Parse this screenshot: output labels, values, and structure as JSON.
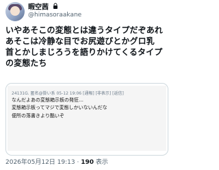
{
  "author": {
    "display_name": "暇空茜",
    "handle": "@himasoraakane"
  },
  "post": {
    "lines": [
      "いやあそこの変態とは違うタイプだぞあれ",
      "あそこは冷静な目でお尻遊びとかグロ乳",
      "首とかしまじろうを語りかけてくるタイプ",
      "の変態たち"
    ]
  },
  "embedded_post": {
    "header": "24131G. 匿名@掛い系 05-12 19:06 [通報] [非表示] [返信]",
    "lines": [
      "なんだよあの変態箱示板の発狂…",
      "変態箱示板ってマジで変態しかいないんだな",
      "便所の落書きより酷いぞ"
    ]
  },
  "meta": {
    "timestamp": "2026年05月12日 19:13",
    "separator": "·",
    "views_count": "190",
    "views_label": "表示"
  }
}
